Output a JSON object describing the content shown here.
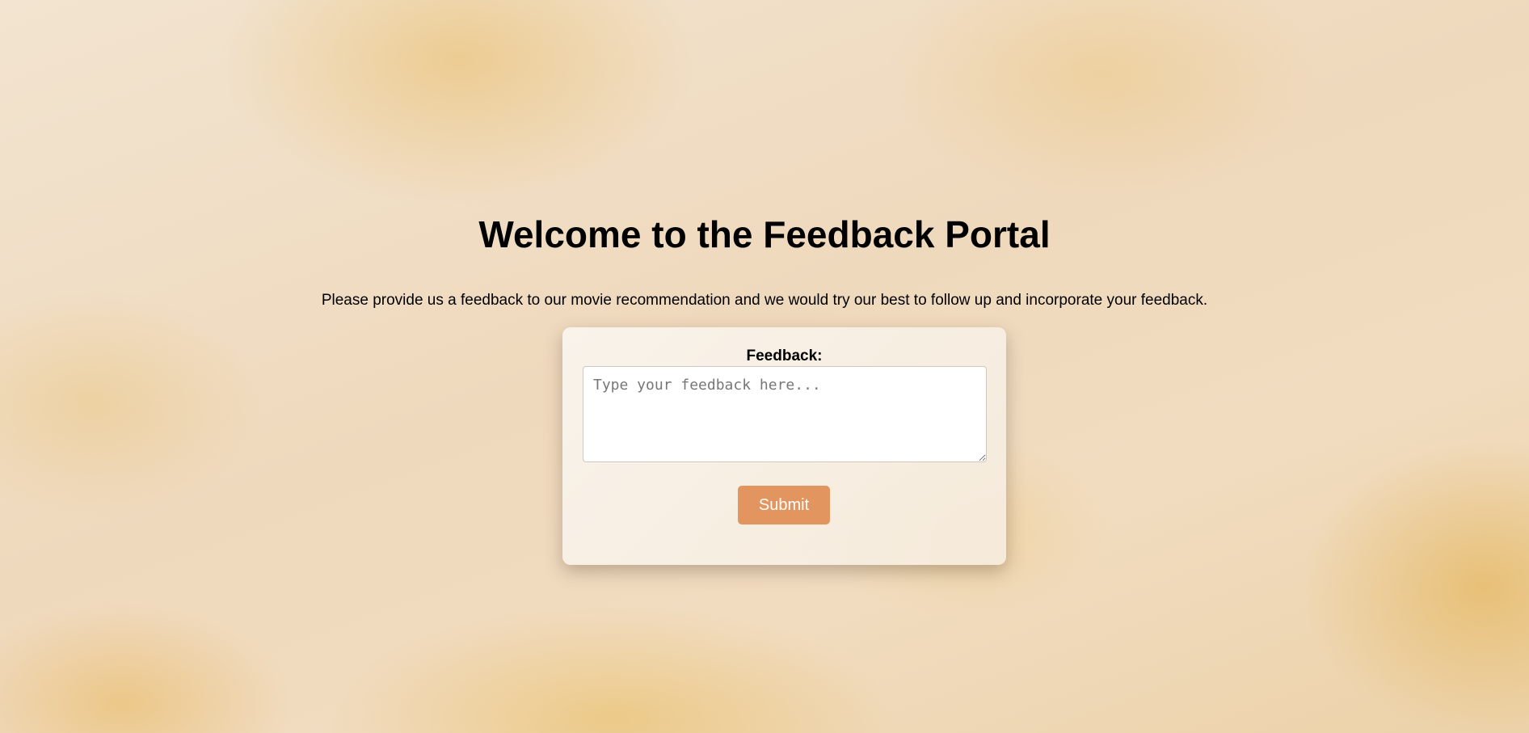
{
  "header": {
    "title": "Welcome to the Feedback Portal",
    "description": "Please provide us a feedback to our movie recommendation and we would try our best to follow up and incorporate your feedback."
  },
  "form": {
    "label": "Feedback:",
    "placeholder": "Type your feedback here...",
    "value": "",
    "submit_label": "Submit"
  },
  "colors": {
    "accent": "#e2955f",
    "card_background": "#f8f1e7"
  }
}
